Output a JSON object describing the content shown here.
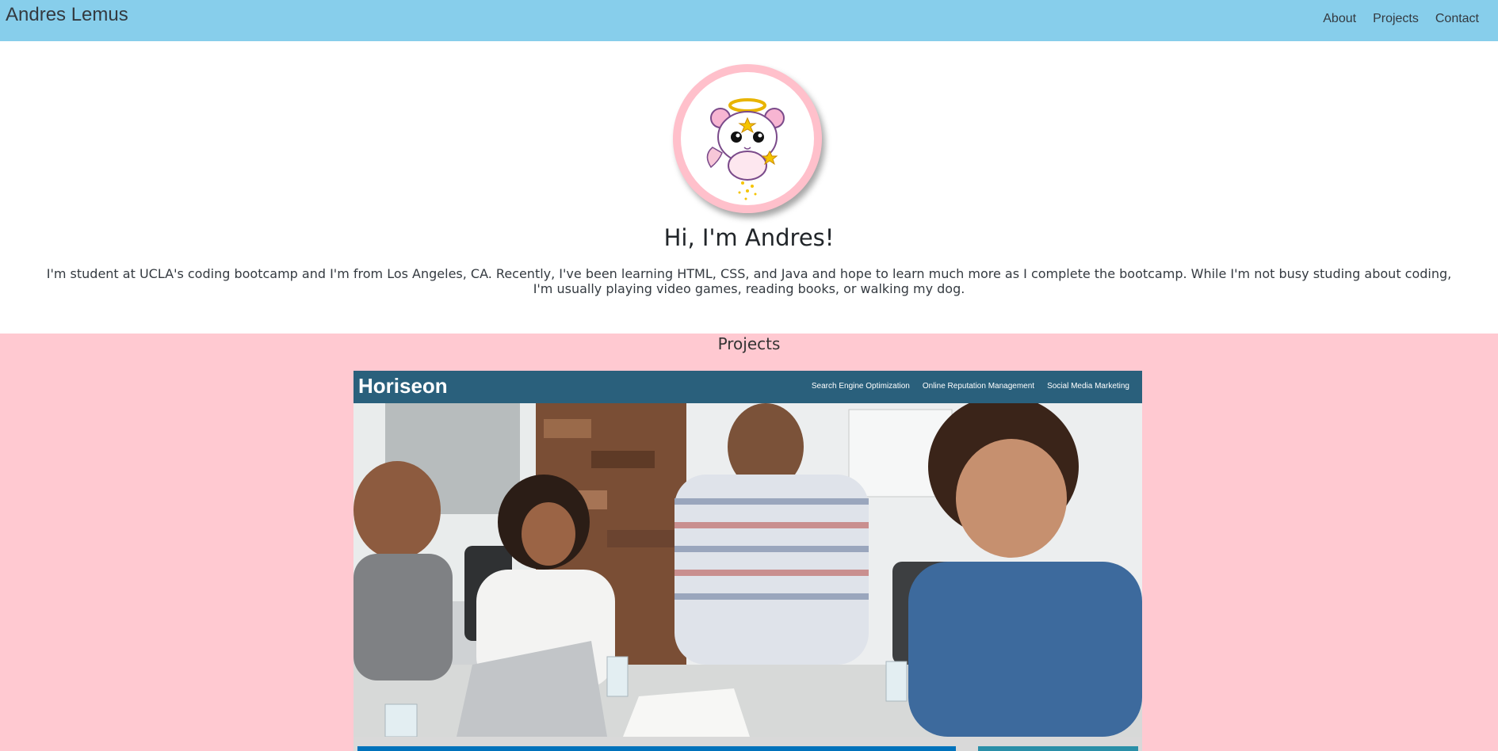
{
  "header": {
    "brand": "Andres Lemus",
    "nav": [
      "About",
      "Projects",
      "Contact"
    ]
  },
  "profile": {
    "avatar_icon": "angel-hamster-icon",
    "greeting": "Hi, I'm Andres!",
    "bio": "I'm student at UCLA's coding bootcamp and I'm from Los Angeles, CA. Recently, I've been learning HTML, CSS, and Java and hope to learn much more as I complete the bootcamp. While I'm not busy studing about coding, I'm usually playing video games, reading books, or walking my dog."
  },
  "projects": {
    "title": "Projects",
    "items": [
      {
        "brand": "Horiseon",
        "nav": [
          "Search Engine Optimization",
          "Online Reputation Management",
          "Social Media Marketing"
        ]
      }
    ]
  },
  "colors": {
    "navbar": "#87ceeb",
    "projects_bg": "#ffc9d1",
    "avatar_ring": "#ffc0cb",
    "horiseon_header": "#2a607c"
  }
}
